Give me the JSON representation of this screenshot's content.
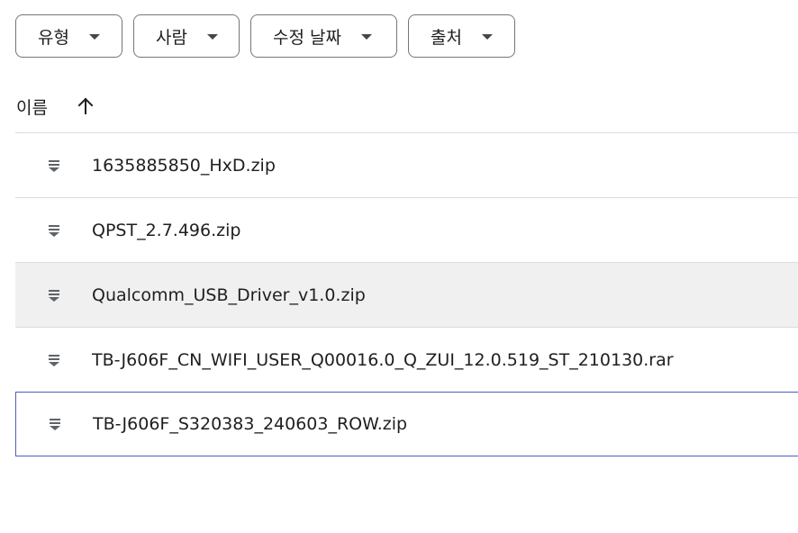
{
  "filters": [
    {
      "label": "유형"
    },
    {
      "label": "사람"
    },
    {
      "label": "수정 날짜"
    },
    {
      "label": "출처"
    }
  ],
  "header": {
    "name_label": "이름",
    "sort_icon": "arrow-up-icon"
  },
  "files": [
    {
      "name": "1635885850_HxD.zip",
      "icon": "archive-icon"
    },
    {
      "name": "QPST_2.7.496.zip",
      "icon": "archive-icon"
    },
    {
      "name": "Qualcomm_USB_Driver_v1.0.zip",
      "icon": "archive-icon"
    },
    {
      "name": "TB-J606F_CN_WIFI_USER_Q00016.0_Q_ZUI_12.0.519_ST_210130.rar",
      "icon": "archive-icon"
    },
    {
      "name": "TB-J606F_S320383_240603_ROW.zip",
      "icon": "archive-icon"
    }
  ],
  "colors": {
    "hover_row": "#f0f0f0",
    "focus_border": "#4a5fc1",
    "divider": "#dadce0",
    "icon": "#5f6368"
  }
}
